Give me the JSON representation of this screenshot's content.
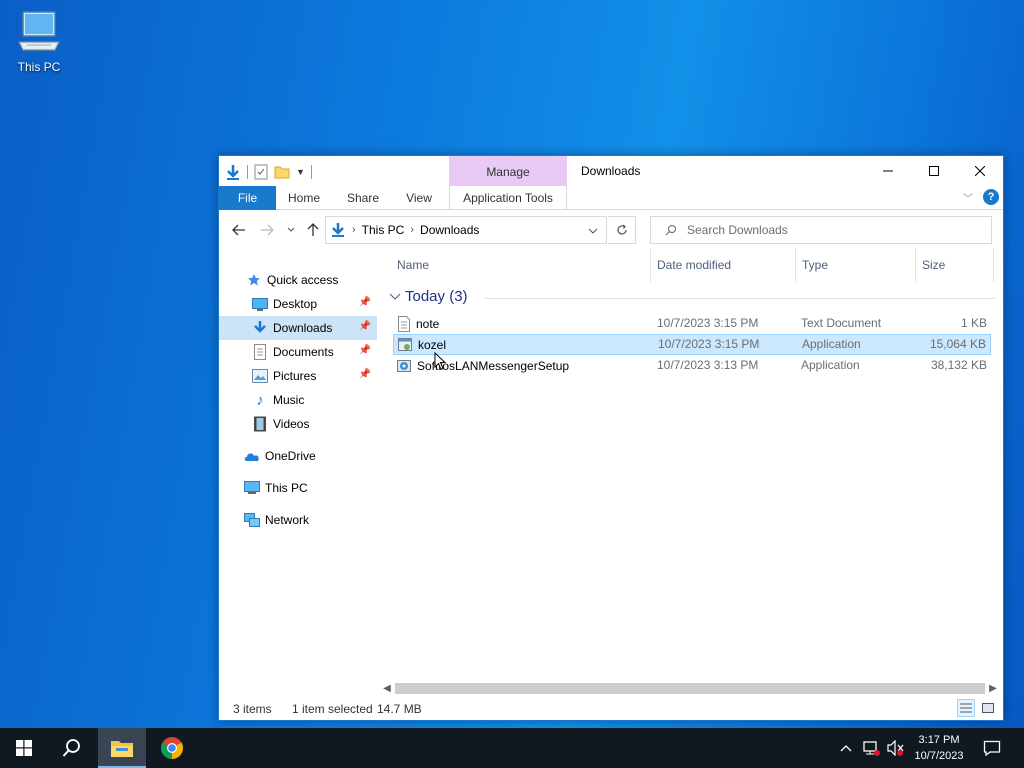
{
  "desktop": {
    "icons": [
      {
        "label": "This PC",
        "icon": "this-pc-icon"
      }
    ]
  },
  "window": {
    "title": "Downloads",
    "contextual_tab_group": "Manage",
    "ribbon_tabs": {
      "file": "File",
      "home": "Home",
      "share": "Share",
      "view": "View",
      "app_tools": "Application Tools"
    },
    "accent": "#1979ca",
    "address": {
      "breadcrumbs": [
        "This PC",
        "Downloads"
      ]
    },
    "search": {
      "placeholder": "Search Downloads",
      "value": ""
    },
    "sidebar": {
      "quick_access": "Quick access",
      "items": [
        {
          "label": "Desktop",
          "pinned": true
        },
        {
          "label": "Downloads",
          "pinned": true,
          "selected": true
        },
        {
          "label": "Documents",
          "pinned": true
        },
        {
          "label": "Pictures",
          "pinned": true
        },
        {
          "label": "Music",
          "pinned": false
        },
        {
          "label": "Videos",
          "pinned": false
        }
      ],
      "onedrive": "OneDrive",
      "this_pc": "This PC",
      "network": "Network"
    },
    "columns": {
      "name": "Name",
      "date": "Date modified",
      "type": "Type",
      "size": "Size"
    },
    "group_label": "Today (3)",
    "files": [
      {
        "name": "note",
        "date": "10/7/2023 3:15 PM",
        "type": "Text Document",
        "size": "1 KB",
        "icon": "text-document-icon"
      },
      {
        "name": "kozel",
        "date": "10/7/2023 3:15 PM",
        "type": "Application",
        "size": "15,064 KB",
        "icon": "application-icon",
        "selected": true
      },
      {
        "name": "SoftrosLANMessengerSetup",
        "date": "10/7/2023 3:13 PM",
        "type": "Application",
        "size": "38,132 KB",
        "icon": "setup-icon"
      }
    ],
    "status": {
      "items": "3 items",
      "selected": "1 item selected",
      "size": "14.7 MB"
    }
  },
  "taskbar": {
    "clock_time": "3:17 PM",
    "clock_date": "10/7/2023",
    "icons": [
      "start-icon",
      "search-icon",
      "file-explorer-icon",
      "chrome-icon"
    ]
  }
}
